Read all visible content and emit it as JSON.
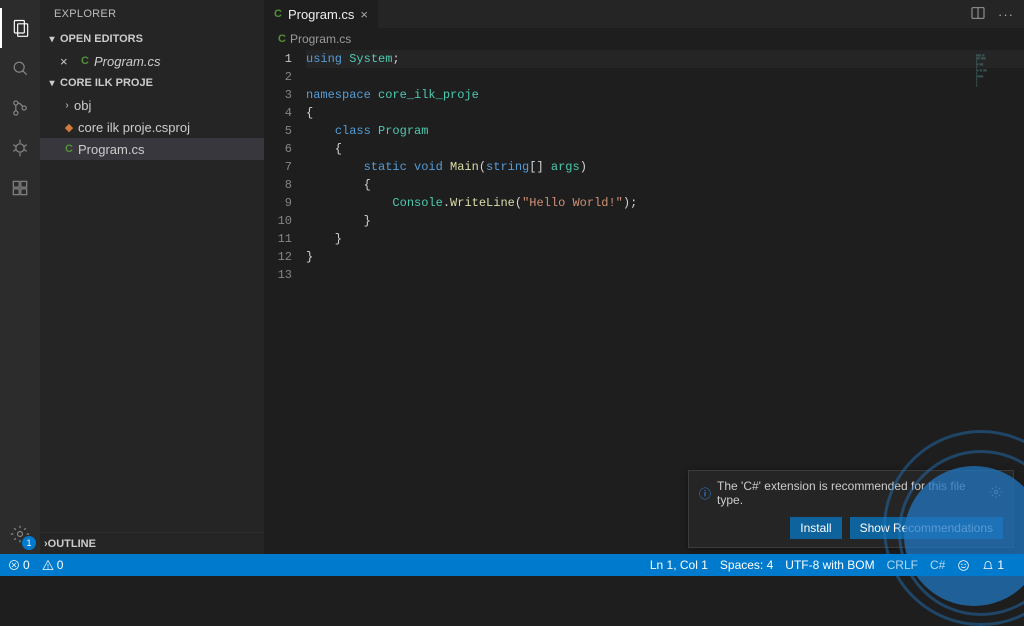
{
  "activity": {
    "settings_badge": "1"
  },
  "sidebar": {
    "title": "EXPLORER",
    "open_editors_label": "OPEN EDITORS",
    "project_label": "CORE ILK PROJE",
    "outline_label": "OUTLINE",
    "open_editors": [
      {
        "name": "Program.cs",
        "icon": "cs"
      }
    ],
    "tree": [
      {
        "name": "obj",
        "type": "folder"
      },
      {
        "name": "core ilk proje.csproj",
        "type": "csproj"
      },
      {
        "name": "Program.cs",
        "type": "cs",
        "active": true
      }
    ]
  },
  "tab": {
    "name": "Program.cs"
  },
  "breadcrumb": {
    "name": "Program.cs"
  },
  "code": {
    "lines": [
      [
        {
          "t": "using ",
          "c": "kw"
        },
        {
          "t": "System",
          "c": "type"
        },
        {
          "t": ";",
          "c": "pn"
        }
      ],
      [
        {
          "t": "",
          "c": "pn"
        }
      ],
      [
        {
          "t": "namespace ",
          "c": "kw"
        },
        {
          "t": "core_ilk_proje",
          "c": "type"
        }
      ],
      [
        {
          "t": "{",
          "c": "pn"
        }
      ],
      [
        {
          "t": "    ",
          "c": "pn"
        },
        {
          "t": "class ",
          "c": "kw"
        },
        {
          "t": "Program",
          "c": "type"
        }
      ],
      [
        {
          "t": "    {",
          "c": "pn"
        }
      ],
      [
        {
          "t": "        ",
          "c": "pn"
        },
        {
          "t": "static void ",
          "c": "kw"
        },
        {
          "t": "Main",
          "c": "fn"
        },
        {
          "t": "(",
          "c": "pn"
        },
        {
          "t": "string",
          "c": "kw"
        },
        {
          "t": "[] ",
          "c": "pn"
        },
        {
          "t": "args",
          "c": "type"
        },
        {
          "t": ")",
          "c": "pn"
        }
      ],
      [
        {
          "t": "        {",
          "c": "pn"
        }
      ],
      [
        {
          "t": "            ",
          "c": "pn"
        },
        {
          "t": "Console",
          "c": "type"
        },
        {
          "t": ".",
          "c": "pn"
        },
        {
          "t": "WriteLine",
          "c": "fn"
        },
        {
          "t": "(",
          "c": "pn"
        },
        {
          "t": "\"Hello World!\"",
          "c": "str"
        },
        {
          "t": ");",
          "c": "pn"
        }
      ],
      [
        {
          "t": "        }",
          "c": "pn"
        }
      ],
      [
        {
          "t": "    }",
          "c": "pn"
        }
      ],
      [
        {
          "t": "}",
          "c": "pn"
        }
      ],
      [
        {
          "t": "",
          "c": "pn"
        }
      ]
    ]
  },
  "notification": {
    "text": "The 'C#' extension is recommended for this file type.",
    "install": "Install",
    "show": "Show Recommendations"
  },
  "status": {
    "errors": "0",
    "warnings": "0",
    "lncol": "Ln 1, Col 1",
    "spaces": "Spaces: 4",
    "encoding": "UTF-8 with BOM",
    "eol": "CRLF",
    "lang": "C#",
    "bell": "1"
  }
}
